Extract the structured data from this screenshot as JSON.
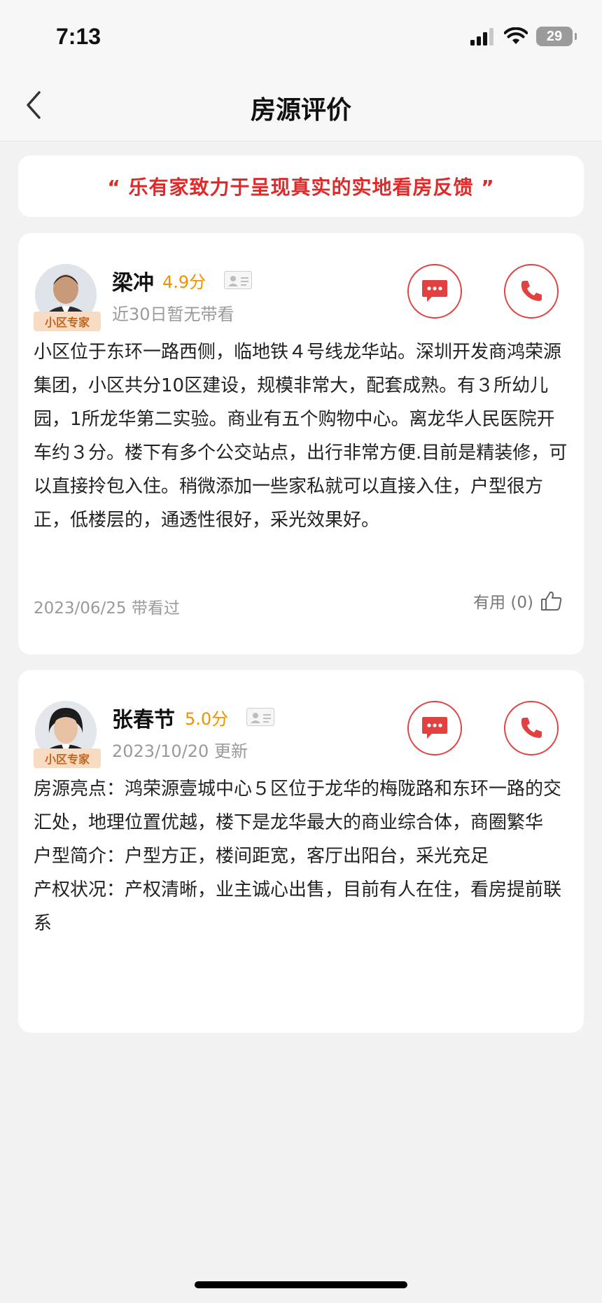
{
  "status_bar": {
    "time": "7:13",
    "battery": "29"
  },
  "header": {
    "title": "房源评价"
  },
  "slogan": "“ 乐有家致力于呈现真实的实地看房反馈 ”",
  "reviews": [
    {
      "name": "梁冲",
      "score": "4.9分",
      "badge": "小区专家",
      "sub": "近30日暂无带看",
      "text": "小区位于东环一路西侧，临地铁４号线龙华站。深圳开发商鸿荣源集团，小区共分10区建设，规模非常大，配套成熟。有３所幼儿园，1所龙华第二实验。商业有五个购物中心。离龙华人民医院开车约３分。楼下有多个公交站点，出行非常方便.目前是精装修，可以直接拎包入住。稍微添加一些家私就可以直接入住，户型很方正，低楼层的，通透性很好，采光效果好。",
      "date": "2023/06/25 带看过",
      "useful": "有用 (0)"
    },
    {
      "name": "张春节",
      "score": "5.0分",
      "badge": "小区专家",
      "sub": "2023/10/20 更新",
      "text": "房源亮点：鸿荣源壹城中心５区位于龙华的梅陇路和东环一路的交汇处，地理位置优越，楼下是龙华最大的商业综合体，商圈繁华\n户型简介：户型方正，楼间距宽，客厅出阳台，采光充足\n产权状况：产权清晰，业主诚心出售，目前有人在住，看房提前联系"
    }
  ],
  "colors": {
    "accent": "#e02a2a",
    "score": "#f29100",
    "badge_bg": "#f7dcc3",
    "badge_text": "#c2651f"
  }
}
